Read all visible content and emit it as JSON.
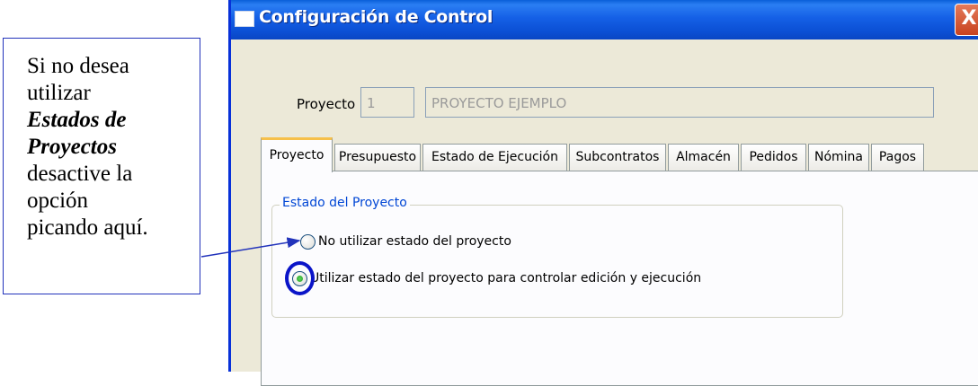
{
  "annotation": {
    "lines": [
      "Si no desea",
      "utilizar",
      "Estados de",
      "Proyectos",
      "desactive la",
      "opción",
      "picando aquí."
    ]
  },
  "window": {
    "title": "Configuración de Control",
    "close_label": "X"
  },
  "project": {
    "label": "Proyecto",
    "code_value": "1",
    "name_value": "PROYECTO EJEMPLO"
  },
  "tabs": [
    {
      "label": "Proyecto",
      "active": true
    },
    {
      "label": "Presupuesto"
    },
    {
      "label": "Estado de Ejecución"
    },
    {
      "label": "Subcontratos"
    },
    {
      "label": "Almacén"
    },
    {
      "label": "Pedidos"
    },
    {
      "label": "Nómina"
    },
    {
      "label": "Pagos"
    }
  ],
  "group": {
    "title": "Estado del Proyecto",
    "options": [
      {
        "label": "No utilizar estado del proyecto",
        "selected": false
      },
      {
        "label": "Utilizar estado del proyecto para controlar edición y ejecución",
        "selected": true
      }
    ]
  },
  "colors": {
    "titlebar": "#0a5fd8",
    "callout_border": "#2233bb",
    "highlight_ring": "#0a14c8",
    "active_tab_accent": "#f6c04a",
    "group_title": "#0046d5"
  }
}
